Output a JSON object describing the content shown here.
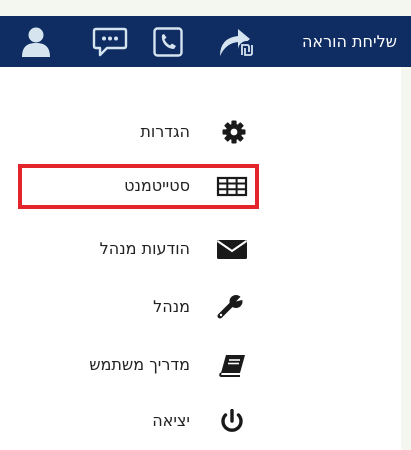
{
  "header": {
    "send_instruction_label": "שליחת הוראה",
    "icons": [
      "user-icon",
      "chat-icon",
      "phone-icon",
      "send-instruction-icon"
    ]
  },
  "menu": {
    "items": [
      {
        "label": "הגדרות",
        "icon": "gear-icon"
      },
      {
        "label": "סטייטמנט",
        "icon": "table-icon",
        "highlighted": true
      },
      {
        "label": "הודעות מנהל",
        "icon": "envelope-icon"
      },
      {
        "label": "מנהל",
        "icon": "wrench-icon"
      },
      {
        "label": "מדריך משתמש",
        "icon": "book-icon"
      },
      {
        "label": "יציאה",
        "icon": "power-icon"
      }
    ]
  },
  "colors": {
    "header_bg": "#0f2d63",
    "icon_light": "#d6e4f0",
    "icon_dark": "#0f2d63",
    "highlight": "#e3242b",
    "page_bg": "#f4f6f0"
  }
}
